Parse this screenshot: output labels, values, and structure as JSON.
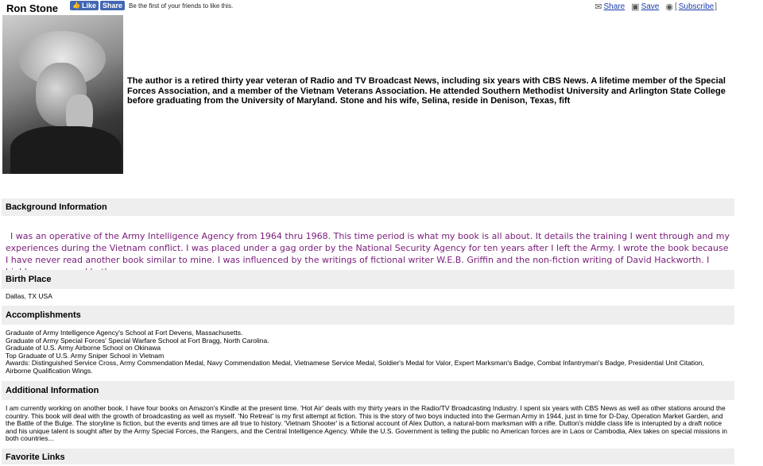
{
  "header": {
    "author_name": "Ron Stone",
    "fb_like": "Like",
    "fb_share": "Share",
    "fb_text": "Be the first of your friends to like this.",
    "share": "Share",
    "save": "Save",
    "subscribe": "Subscribe",
    "icons": [
      "envelope-icon",
      "save-icon",
      "rss-icon"
    ]
  },
  "bio": "The author is a retired thirty year veteran of Radio and TV Broadcast News, including six years with CBS News. A lifetime member of the Special Forces Association, and a member of the Vietnam Veterans Association. He attended Southern Methodist University and Arlington State College before graduating from the University of Maryland. Stone and his wife, Selina, reside in Denison, Texas, fift",
  "sections": {
    "background": {
      "heading": "Background Information",
      "text": "I was an operative of the Army Intelligence Agency from 1964 thru 1968. This time period is what my book is all about. It details the training I went through and my experiences during the Vietnam conflict. I was placed under a gag order by the National Security Agency for ten years after I left the Army. I wrote the book because I have never read another book similar to mine. I was influenced by the writings of fictional writer W.E.B. Griffin and the non-fiction writing of David Hackworth. I highly recommend both."
    },
    "birthplace": {
      "heading": "Birth Place",
      "text": "Dallas, TX USA"
    },
    "accomplishments": {
      "heading": "Accomplishments",
      "lines": [
        "Graduate of Army Intelligence Agency's School at Fort Devens, Massachusetts.",
        "Graduate of Army Special Forces' Special Warfare School at Fort Bragg, North Carolina.",
        "Graduate of U.S. Army Airborne School on Okinawa",
        "Top Graduate of U.S. Army Sniper School in Vietnam",
        "Awards: Distinguished Service Cross, Army Commendation Medal, Navy Commendation Medal, Vietnamese Service Medal, Soldier's Medal for Valor, Expert Marksman's Badge, Combat Infantryman's Badge, Presidential Unit Citation, Airborne Qualification Wings."
      ]
    },
    "additional": {
      "heading": "Additional Information",
      "text": "I am currently working on another book. I have four books on Amazon's Kindle at the present time. 'Hot Air' deals with my thirty years in the Radio/TV Broadcasting Industry. I spent six years with CBS News as well as other stations around the country. This book will deal with the growth of broadcasting as well as myself. 'No Retreat' is my first attempt at fiction. This is the story of two boys inducted into the German Army in 1944, just in time for D-Day, Operation Market Garden, and the Battle of the Bulge. The storyline is fiction, but the events and times are all true to history. 'Vietnam Shooter' is a fictional account of Alex Dutton, a natural-born marksman with a rifle. Dutton's middle class life is interupted by a draft notice and his unique talent is sought after by the Army Special Forces, the Rangers, and the Central Intelligence Agency. While the U.S. Government is telling the public no American forces are in Laos or Cambodia, Alex takes on special missions in both countries..."
    },
    "favorite_links": {
      "heading": "Favorite Links"
    }
  }
}
